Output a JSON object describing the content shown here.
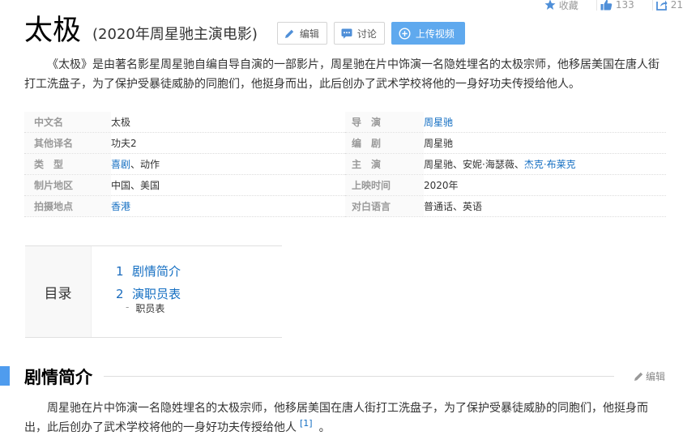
{
  "stats": {
    "collect_label": "收藏",
    "likes": "133",
    "shares": "21"
  },
  "title": {
    "main": "太极",
    "sub": "(2020年周星驰主演电影)"
  },
  "buttons": {
    "edit": "编辑",
    "discuss": "讨论",
    "upload": "上传视频"
  },
  "summary": "《太极》是由著名影星周星驰自编自导自演的一部影片，周星驰在片中饰演一名隐姓埋名的太极宗师，他移居美国在唐人街打工洗盘子，为了保护受暴徒威胁的同胞们，他挺身而出，此后创办了武术学校将他的一身好功夫传授给他人。",
  "basic_left": [
    {
      "key": "中文名",
      "value": "太极"
    },
    {
      "key": "其他译名",
      "value": "功夫2"
    },
    {
      "key": "类　型",
      "link": "喜剧",
      "rest": "、动作"
    },
    {
      "key": "制片地区",
      "value": "中国、美国"
    },
    {
      "key": "拍摄地点",
      "link": "香港"
    }
  ],
  "basic_right": [
    {
      "key": "导　演",
      "link": "周星驰"
    },
    {
      "key": "编　剧",
      "value": "周星驰"
    },
    {
      "key": "主　演",
      "value": "周星驰、安妮·海瑟薇、",
      "link": "杰克·布莱克"
    },
    {
      "key": "上映时间",
      "value": "2020年"
    },
    {
      "key": "对白语言",
      "value": "普通话、英语"
    }
  ],
  "catalog": {
    "label": "目录",
    "items": [
      {
        "num": "1",
        "label": "剧情简介"
      },
      {
        "num": "2",
        "label": "演职员表"
      }
    ],
    "sub": {
      "bullet": "-",
      "label": "职员表"
    }
  },
  "section": {
    "title": "剧情简介",
    "edit": "编辑"
  },
  "section_text": "周星驰在片中饰演一名隐姓埋名的太极宗师，他移居美国在唐人街打工洗盘子，为了保护受暴徒威胁的同胞们，他挺身而出，此后创办了武术学校将他的一身好功夫传授给他人",
  "section_ref": "[1]",
  "section_end": "。",
  "colors": {
    "link": "#136ec2",
    "accent": "#4f9cee",
    "primary_button": "#5fa9ee"
  }
}
